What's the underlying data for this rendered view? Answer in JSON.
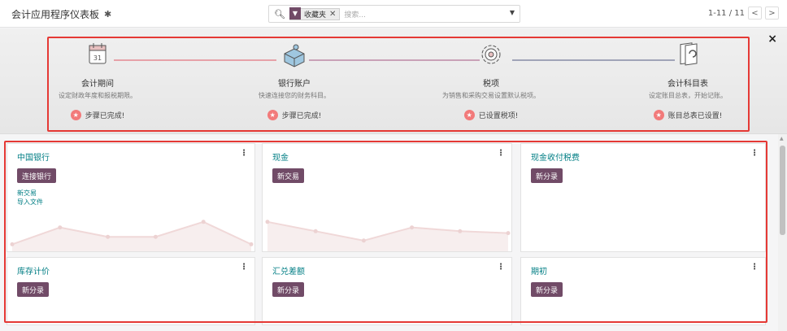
{
  "topbar": {
    "title": "会计应用程序仪表板",
    "search": {
      "facet_label": "收藏夹",
      "placeholder": "搜索..."
    },
    "pager": {
      "text": "1-11 / 11",
      "prev": "<",
      "next": ">"
    }
  },
  "onboarding": {
    "close": "×",
    "steps": [
      {
        "title": "会计期间",
        "desc": "设定财政年度和报税期限。",
        "status": "步骤已完成!"
      },
      {
        "title": "银行账户",
        "desc": "快速连接您的财务科目。",
        "status": "步骤已完成!"
      },
      {
        "title": "税项",
        "desc": "为销售和采购交易设置默认税项。",
        "status": "已设置税项!"
      },
      {
        "title": "会计科目表",
        "desc": "设定账目总表，开始记账。",
        "status": "账目总表已设置!"
      }
    ]
  },
  "journals": [
    {
      "name": "中国银行",
      "button": "连接银行",
      "links": [
        "新交易",
        "导入文件"
      ],
      "graph": [
        0.1,
        0.55,
        0.3,
        0.3,
        0.7,
        0.1
      ]
    },
    {
      "name": "现金",
      "button": "新交易",
      "links": [],
      "graph": [
        0.7,
        0.45,
        0.2,
        0.55,
        0.45,
        0.4
      ]
    },
    {
      "name": "现金收付税费",
      "button": "新分录",
      "links": []
    },
    {
      "name": "库存计价",
      "button": "新分录",
      "links": []
    },
    {
      "name": "汇兑差额",
      "button": "新分录",
      "links": []
    },
    {
      "name": "期初",
      "button": "新分录",
      "links": []
    }
  ],
  "colors": {
    "brand": "#714b67",
    "link": "#017e84",
    "highlight": "#e53935",
    "star": "#f27a7a"
  }
}
